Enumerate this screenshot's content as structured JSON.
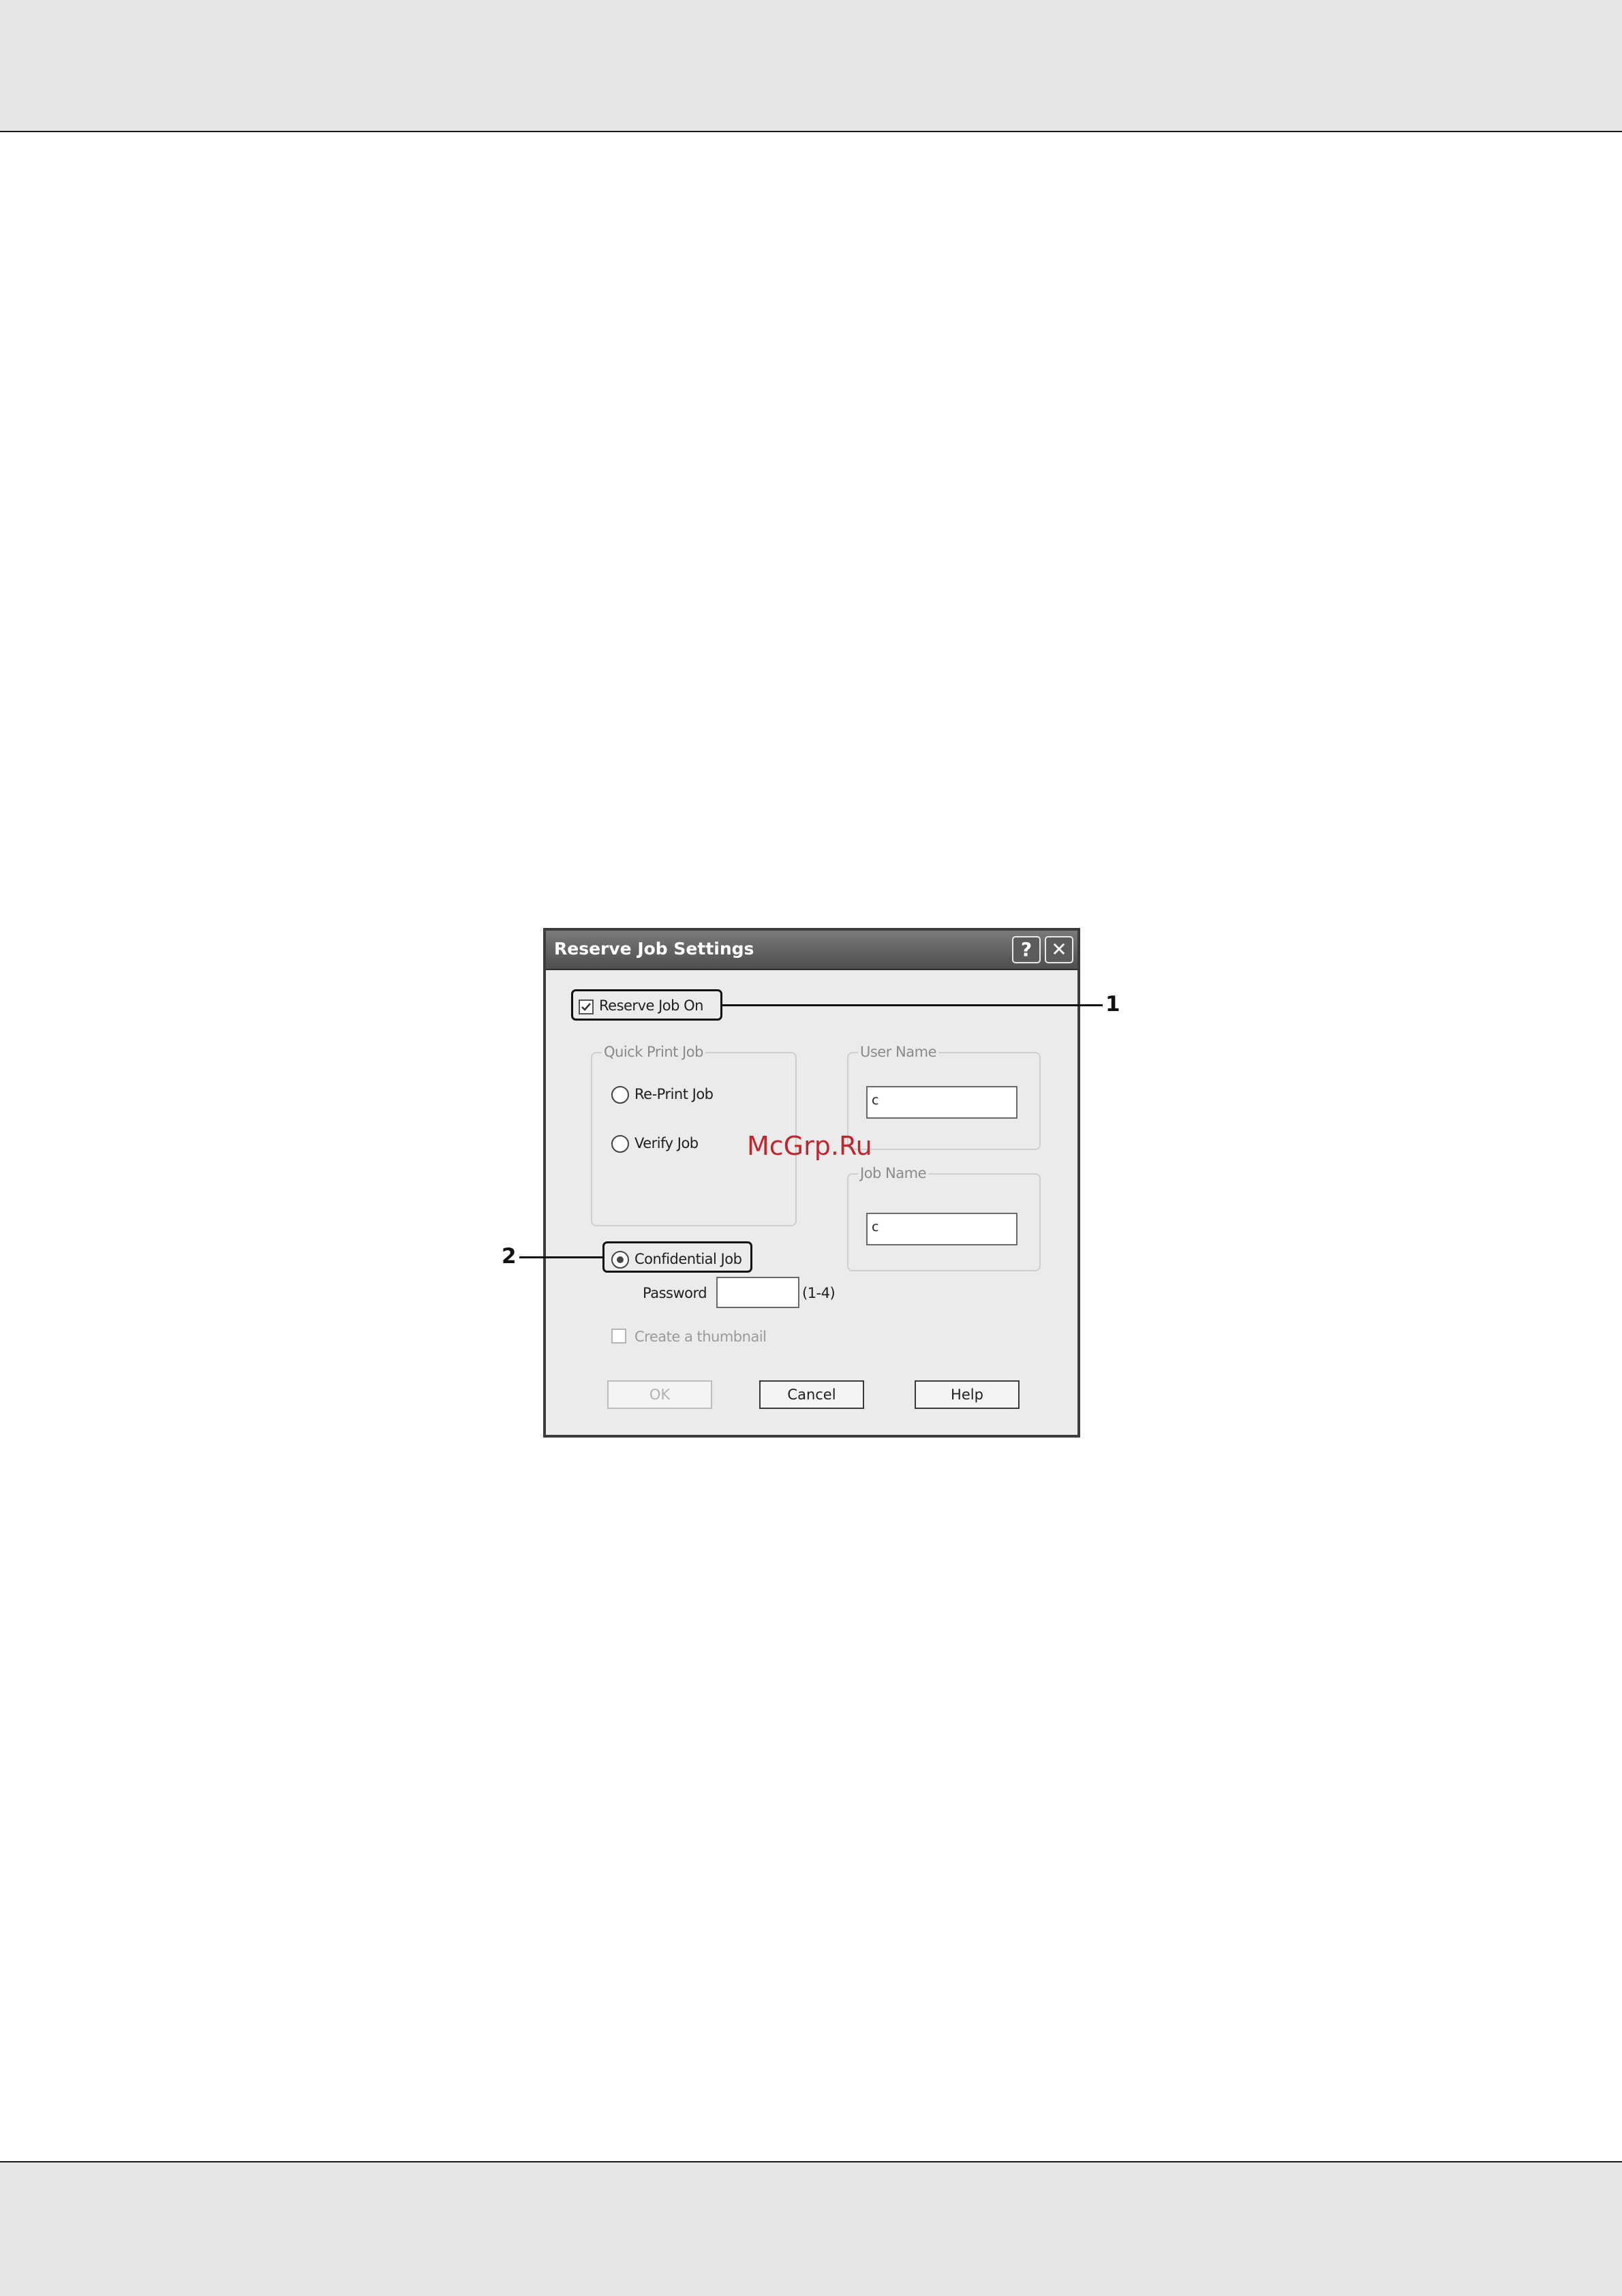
{
  "dialog": {
    "title": "Reserve Job Settings",
    "help_button": "?",
    "close_button": "✕",
    "reserve_job_on": {
      "label": "Reserve Job On",
      "checked": true
    },
    "quick_print_job": {
      "legend": "Quick Print Job",
      "options": [
        {
          "label": "Re-Print Job",
          "selected": false
        },
        {
          "label": "Verify Job",
          "selected": false
        }
      ]
    },
    "user_name": {
      "legend": "User Name",
      "value": "c"
    },
    "job_name": {
      "legend": "Job Name",
      "value": "c"
    },
    "confidential_job": {
      "label": "Confidential Job",
      "selected": true
    },
    "password": {
      "label": "Password",
      "value": "",
      "hint": "(1-4)"
    },
    "create_thumbnail": {
      "label": "Create a thumbnail",
      "checked": false,
      "enabled": false
    },
    "buttons": {
      "ok": "OK",
      "cancel": "Cancel",
      "help": "Help"
    }
  },
  "callouts": {
    "one": "1",
    "two": "2"
  },
  "watermark": "McGrp.Ru"
}
